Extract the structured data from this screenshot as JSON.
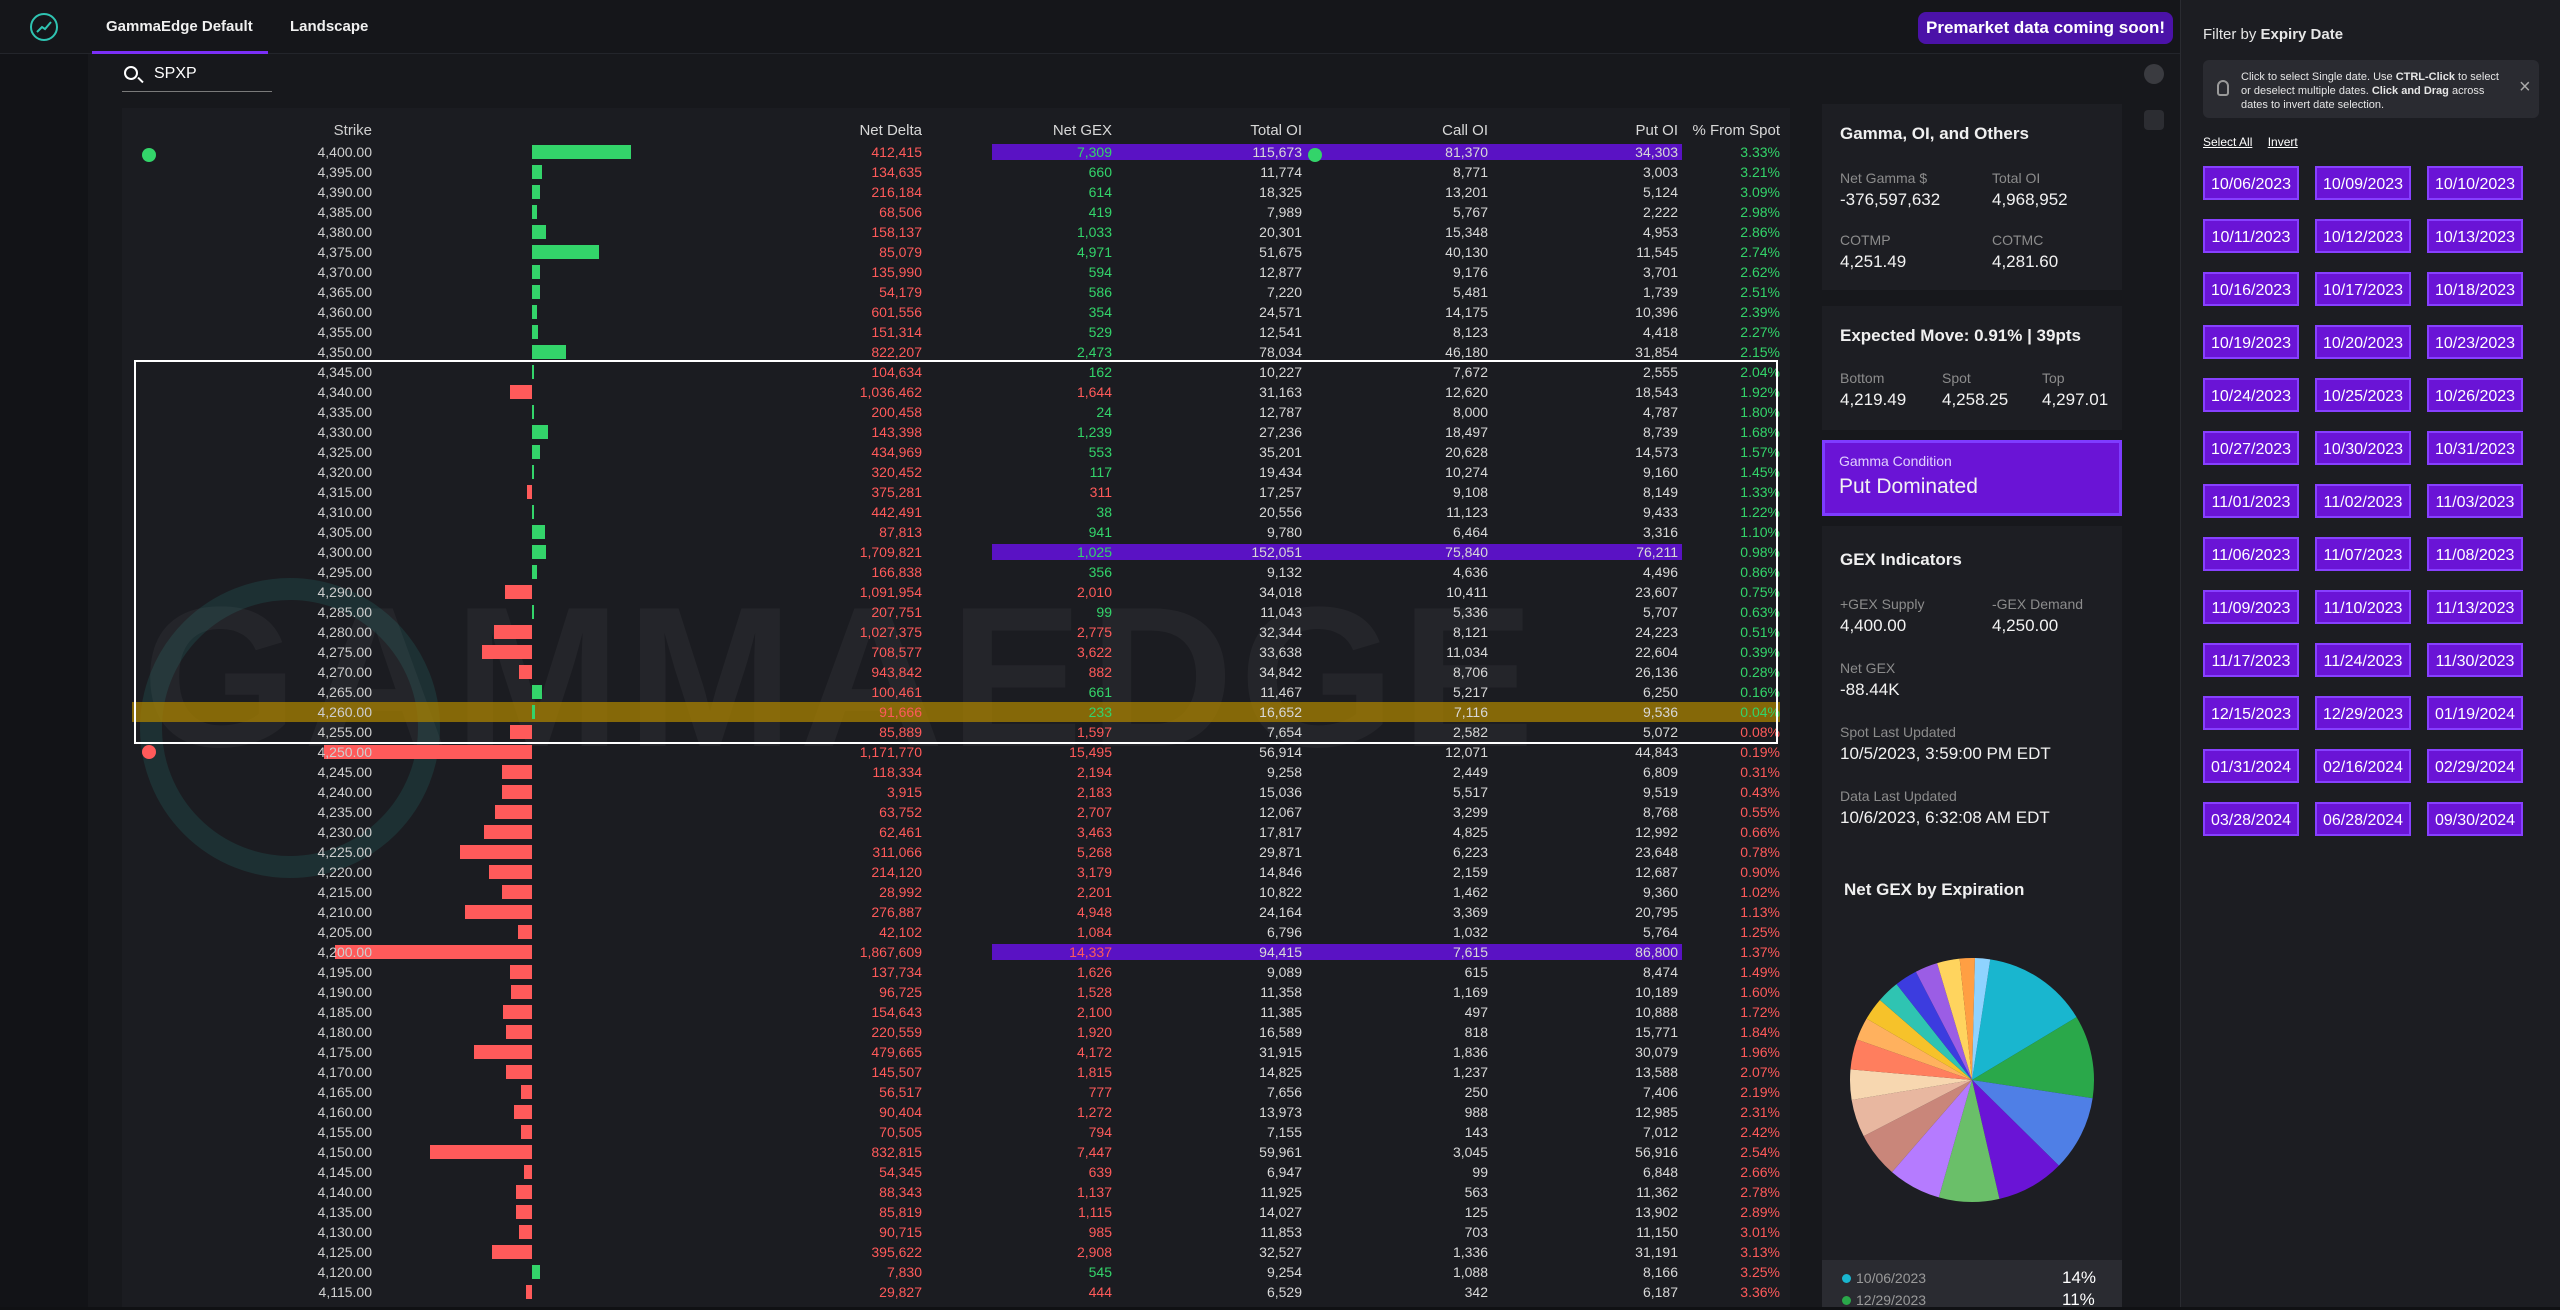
{
  "nav": {
    "tab_default": "GammaEdge Default",
    "tab_landscape": "Landscape",
    "premarket": "Premarket data coming soon!"
  },
  "search": {
    "value": "SPXP"
  },
  "table": {
    "headers": {
      "strike": "Strike",
      "net_delta": "Net Delta",
      "net_gex": "Net GEX",
      "total_oi": "Total OI",
      "call_oi": "Call OI",
      "put_oi": "Put OI",
      "pct_spot": "% From Spot"
    },
    "rows": [
      [
        "4,400.00",
        "412,415",
        "7,309",
        "115,673",
        "81,370",
        "34,303",
        "3.33%",
        0.62,
        1,
        1
      ],
      [
        "4,395.00",
        "134,635",
        "660",
        "11,774",
        "8,771",
        "3,003",
        "3.21%",
        0.06,
        1,
        0
      ],
      [
        "4,390.00",
        "216,184",
        "614",
        "18,325",
        "13,201",
        "5,124",
        "3.09%",
        0.05,
        1,
        0
      ],
      [
        "4,385.00",
        "68,506",
        "419",
        "7,989",
        "5,767",
        "2,222",
        "2.98%",
        0.03,
        1,
        0
      ],
      [
        "4,380.00",
        "158,137",
        "1,033",
        "20,301",
        "15,348",
        "4,953",
        "2.86%",
        0.09,
        1,
        0
      ],
      [
        "4,375.00",
        "85,079",
        "4,971",
        "51,675",
        "40,130",
        "11,545",
        "2.74%",
        0.42,
        1,
        0
      ],
      [
        "4,370.00",
        "135,990",
        "594",
        "12,877",
        "9,176",
        "3,701",
        "2.62%",
        0.05,
        1,
        0
      ],
      [
        "4,365.00",
        "54,179",
        "586",
        "7,220",
        "5,481",
        "1,739",
        "2.51%",
        0.05,
        1,
        0
      ],
      [
        "4,360.00",
        "601,556",
        "354",
        "24,571",
        "14,175",
        "10,396",
        "2.39%",
        0.03,
        1,
        0
      ],
      [
        "4,355.00",
        "151,314",
        "529",
        "12,541",
        "8,123",
        "4,418",
        "2.27%",
        0.04,
        1,
        0
      ],
      [
        "4,350.00",
        "822,207",
        "2,473",
        "78,034",
        "46,180",
        "31,854",
        "2.15%",
        0.21,
        1,
        0
      ],
      [
        "4,345.00",
        "104,634",
        "162",
        "10,227",
        "7,672",
        "2,555",
        "2.04%",
        0.01,
        1,
        0
      ],
      [
        "4,340.00",
        "1,036,462",
        "1,644",
        "31,163",
        "12,620",
        "18,543",
        "1.92%",
        0.14,
        0,
        0
      ],
      [
        "4,335.00",
        "200,458",
        "24",
        "12,787",
        "8,000",
        "4,787",
        "1.80%",
        0.01,
        1,
        0
      ],
      [
        "4,330.00",
        "143,398",
        "1,239",
        "27,236",
        "18,497",
        "8,739",
        "1.68%",
        0.1,
        1,
        0
      ],
      [
        "4,325.00",
        "434,969",
        "553",
        "35,201",
        "20,628",
        "14,573",
        "1.57%",
        0.05,
        1,
        0
      ],
      [
        "4,320.00",
        "320,452",
        "117",
        "19,434",
        "10,274",
        "9,160",
        "1.45%",
        0.01,
        1,
        0
      ],
      [
        "4,315.00",
        "375,281",
        "311",
        "17,257",
        "9,108",
        "8,149",
        "1.33%",
        0.03,
        0,
        0
      ],
      [
        "4,310.00",
        "442,491",
        "38",
        "20,556",
        "11,123",
        "9,433",
        "1.22%",
        0.01,
        1,
        0
      ],
      [
        "4,305.00",
        "87,813",
        "941",
        "9,780",
        "6,464",
        "3,316",
        "1.10%",
        0.08,
        1,
        0
      ],
      [
        "4,300.00",
        "1,709,821",
        "1,025",
        "152,051",
        "75,840",
        "76,211",
        "0.98%",
        0.09,
        1,
        1
      ],
      [
        "4,295.00",
        "166,838",
        "356",
        "9,132",
        "4,636",
        "4,496",
        "0.86%",
        0.03,
        1,
        0
      ],
      [
        "4,290.00",
        "1,091,954",
        "2,010",
        "34,018",
        "10,411",
        "23,607",
        "0.75%",
        0.17,
        0,
        0
      ],
      [
        "4,285.00",
        "207,751",
        "99",
        "11,043",
        "5,336",
        "5,707",
        "0.63%",
        0.01,
        1,
        0
      ],
      [
        "4,280.00",
        "1,027,375",
        "2,775",
        "32,344",
        "8,121",
        "24,223",
        "0.51%",
        0.24,
        0,
        0
      ],
      [
        "4,275.00",
        "708,577",
        "3,622",
        "33,638",
        "11,034",
        "22,604",
        "0.39%",
        0.31,
        0,
        0
      ],
      [
        "4,270.00",
        "943,842",
        "882",
        "34,842",
        "8,706",
        "26,136",
        "0.28%",
        0.08,
        0,
        0
      ],
      [
        "4,265.00",
        "100,461",
        "661",
        "11,467",
        "5,217",
        "6,250",
        "0.16%",
        0.06,
        1,
        0
      ],
      [
        "4,260.00",
        "91,666",
        "233",
        "16,652",
        "7,116",
        "9,536",
        "0.04%",
        0.02,
        1,
        0
      ],
      [
        "4,255.00",
        "85,889",
        "1,597",
        "7,654",
        "2,582",
        "5,072",
        "0.08%",
        0.14,
        0,
        0
      ],
      [
        "4,250.00",
        "1,171,770",
        "15,495",
        "56,914",
        "12,071",
        "44,843",
        "0.19%",
        1.3,
        0,
        0
      ],
      [
        "4,245.00",
        "118,334",
        "2,194",
        "9,258",
        "2,449",
        "6,809",
        "0.31%",
        0.19,
        0,
        0
      ],
      [
        "4,240.00",
        "3,915",
        "2,183",
        "15,036",
        "5,517",
        "9,519",
        "0.43%",
        0.19,
        0,
        0
      ],
      [
        "4,235.00",
        "63,752",
        "2,707",
        "12,067",
        "3,299",
        "8,768",
        "0.55%",
        0.23,
        0,
        0
      ],
      [
        "4,230.00",
        "62,461",
        "3,463",
        "17,817",
        "4,825",
        "12,992",
        "0.66%",
        0.3,
        0,
        0
      ],
      [
        "4,225.00",
        "311,066",
        "5,268",
        "29,871",
        "6,223",
        "23,648",
        "0.78%",
        0.45,
        0,
        0
      ],
      [
        "4,220.00",
        "214,120",
        "3,179",
        "14,846",
        "2,159",
        "12,687",
        "0.90%",
        0.27,
        0,
        0
      ],
      [
        "4,215.00",
        "28,992",
        "2,201",
        "10,822",
        "1,462",
        "9,360",
        "1.02%",
        0.19,
        0,
        0
      ],
      [
        "4,210.00",
        "276,887",
        "4,948",
        "24,164",
        "3,369",
        "20,795",
        "1.13%",
        0.42,
        0,
        0
      ],
      [
        "4,205.00",
        "42,102",
        "1,084",
        "6,796",
        "1,032",
        "5,764",
        "1.25%",
        0.09,
        0,
        0
      ],
      [
        "4,200.00",
        "1,867,609",
        "14,337",
        "94,415",
        "7,615",
        "86,800",
        "1.37%",
        1.23,
        0,
        1
      ],
      [
        "4,195.00",
        "137,734",
        "1,626",
        "9,089",
        "615",
        "8,474",
        "1.49%",
        0.14,
        0,
        0
      ],
      [
        "4,190.00",
        "96,725",
        "1,528",
        "11,358",
        "1,169",
        "10,189",
        "1.60%",
        0.13,
        0,
        0
      ],
      [
        "4,185.00",
        "154,643",
        "2,100",
        "11,385",
        "497",
        "10,888",
        "1.72%",
        0.18,
        0,
        0
      ],
      [
        "4,180.00",
        "220,559",
        "1,920",
        "16,589",
        "818",
        "15,771",
        "1.84%",
        0.16,
        0,
        0
      ],
      [
        "4,175.00",
        "479,665",
        "4,172",
        "31,915",
        "1,836",
        "30,079",
        "1.96%",
        0.36,
        0,
        0
      ],
      [
        "4,170.00",
        "145,507",
        "1,815",
        "14,825",
        "1,237",
        "13,588",
        "2.07%",
        0.16,
        0,
        0
      ],
      [
        "4,165.00",
        "56,517",
        "777",
        "7,656",
        "250",
        "7,406",
        "2.19%",
        0.07,
        0,
        0
      ],
      [
        "4,160.00",
        "90,404",
        "1,272",
        "13,973",
        "988",
        "12,985",
        "2.31%",
        0.11,
        0,
        0
      ],
      [
        "4,155.00",
        "70,505",
        "794",
        "7,155",
        "143",
        "7,012",
        "2.42%",
        0.07,
        0,
        0
      ],
      [
        "4,150.00",
        "832,815",
        "7,447",
        "59,961",
        "3,045",
        "56,916",
        "2.54%",
        0.64,
        0,
        0
      ],
      [
        "4,145.00",
        "54,345",
        "639",
        "6,947",
        "99",
        "6,848",
        "2.66%",
        0.05,
        0,
        0
      ],
      [
        "4,140.00",
        "88,343",
        "1,137",
        "11,925",
        "563",
        "11,362",
        "2.78%",
        0.1,
        0,
        0
      ],
      [
        "4,135.00",
        "85,819",
        "1,115",
        "14,027",
        "125",
        "13,902",
        "2.89%",
        0.1,
        0,
        0
      ],
      [
        "4,130.00",
        "90,715",
        "985",
        "11,853",
        "703",
        "11,150",
        "3.01%",
        0.08,
        0,
        0
      ],
      [
        "4,125.00",
        "395,622",
        "2,908",
        "32,527",
        "1,336",
        "31,191",
        "3.13%",
        0.25,
        0,
        0
      ],
      [
        "4,120.00",
        "7,830",
        "545",
        "9,254",
        "1,088",
        "8,166",
        "3.25%",
        0.05,
        1,
        0
      ],
      [
        "4,115.00",
        "29,827",
        "444",
        "6,529",
        "342",
        "6,187",
        "3.36%",
        0.04,
        0,
        0
      ]
    ]
  },
  "cards": {
    "gamma_oi": {
      "title": "Gamma, OI, and Others",
      "net_gamma_label": "Net Gamma $",
      "net_gamma": "-376,597,632",
      "total_oi_label": "Total OI",
      "total_oi": "4,968,952",
      "cotmp_label": "COTMP",
      "cotmp": "4,251.49",
      "cotmc_label": "COTMC",
      "cotmc": "4,281.60"
    },
    "expected": {
      "title": "Expected Move: 0.91% | 39pts",
      "bottom_label": "Bottom",
      "bottom": "4,219.49",
      "spot_label": "Spot",
      "spot": "4,258.25",
      "top_label": "Top",
      "top": "4,297.01"
    },
    "condition": {
      "label": "Gamma Condition",
      "value": "Put Dominated"
    },
    "gex": {
      "title": "GEX Indicators",
      "supply_label": "+GEX Supply",
      "supply": "4,400.00",
      "demand_label": "-GEX Demand",
      "demand": "4,250.00",
      "net_label": "Net GEX",
      "net": "-88.44K",
      "spot_upd_label": "Spot Last Updated",
      "spot_upd": "10/5/2023, 3:59:00 PM EDT",
      "data_upd_label": "Data Last Updated",
      "data_upd": "10/6/2023, 6:32:08 AM EDT"
    },
    "pie": {
      "title": "Net GEX by Expiration"
    }
  },
  "chart_data": {
    "type": "pie",
    "title": "Net GEX by Expiration",
    "legend": [
      {
        "label": "10/06/2023",
        "value": 14,
        "display": "14%"
      },
      {
        "label": "12/29/2023",
        "value": 11,
        "display": "11%"
      }
    ],
    "colors": [
      "#19b6cf",
      "#2aa84a",
      "#4f7fe6",
      "#6a14d6",
      "#6abf69",
      "#b57bff",
      "#c9867a",
      "#e8b7a0",
      "#f7d7b0",
      "#ff7e5e",
      "#ffb15e",
      "#f6c22a",
      "#2fc4b2",
      "#3c3cdf",
      "#9b5de5",
      "#ffd45e",
      "#ff9f43",
      "#8fd3ff"
    ],
    "values": [
      14,
      11,
      10,
      9,
      8,
      7,
      6,
      5,
      4,
      4,
      3,
      3,
      3,
      3,
      3,
      3,
      2,
      2
    ]
  },
  "filter": {
    "title_prefix": "Filter by ",
    "title_bold": "Expiry Date",
    "info_a": "Click to select Single date. Use ",
    "info_b": "CTRL-Click",
    "info_c": " to select or deselect multiple dates. ",
    "info_d": "Click and Drag",
    "info_e": " across dates to invert date selection.",
    "select_all": "Select All",
    "invert": "Invert",
    "dates": [
      "10/06/2023",
      "10/09/2023",
      "10/10/2023",
      "10/11/2023",
      "10/12/2023",
      "10/13/2023",
      "10/16/2023",
      "10/17/2023",
      "10/18/2023",
      "10/19/2023",
      "10/20/2023",
      "10/23/2023",
      "10/24/2023",
      "10/25/2023",
      "10/26/2023",
      "10/27/2023",
      "10/30/2023",
      "10/31/2023",
      "11/01/2023",
      "11/02/2023",
      "11/03/2023",
      "11/06/2023",
      "11/07/2023",
      "11/08/2023",
      "11/09/2023",
      "11/10/2023",
      "11/13/2023",
      "11/17/2023",
      "11/24/2023",
      "11/30/2023",
      "12/15/2023",
      "12/29/2023",
      "01/19/2024",
      "01/31/2024",
      "02/16/2024",
      "02/29/2024",
      "03/28/2024",
      "06/28/2024",
      "09/30/2024"
    ]
  },
  "watermark": "GAMMAEDGE"
}
